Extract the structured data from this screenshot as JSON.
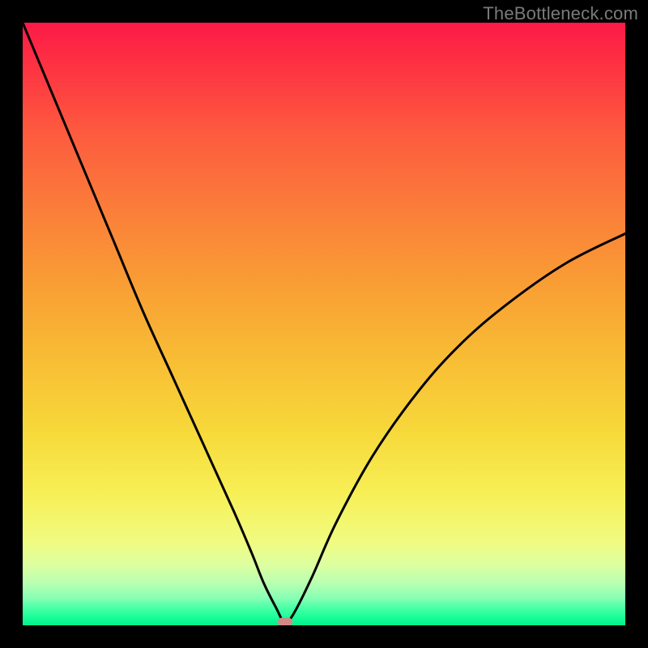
{
  "watermark": "TheBottleneck.com",
  "chart_data": {
    "type": "line",
    "title": "",
    "xlabel": "",
    "ylabel": "",
    "xlim": [
      0,
      100
    ],
    "ylim": [
      0,
      100
    ],
    "grid": false,
    "legend": false,
    "background": {
      "type": "gradient",
      "direction": "vertical",
      "stops": [
        {
          "pos": 0,
          "color": "#fd1a47"
        },
        {
          "pos": 50,
          "color": "#f8bb34"
        },
        {
          "pos": 85,
          "color": "#f1fb80"
        },
        {
          "pos": 100,
          "color": "#00f08c"
        }
      ]
    },
    "series": [
      {
        "name": "bottleneck-curve",
        "color": "#000000",
        "x": [
          0,
          5,
          10,
          15,
          20,
          25,
          30,
          35,
          38,
          40,
          42,
          43.5,
          45,
          48,
          52,
          58,
          65,
          72,
          80,
          90,
          100
        ],
        "y": [
          100,
          88,
          76,
          64,
          52,
          41,
          30,
          19,
          12,
          7,
          3,
          0.5,
          2,
          8,
          17,
          28,
          38,
          46,
          53,
          60,
          65
        ]
      }
    ],
    "marker": {
      "x": 43.5,
      "y": 0.5,
      "color": "#cf8b85"
    }
  }
}
